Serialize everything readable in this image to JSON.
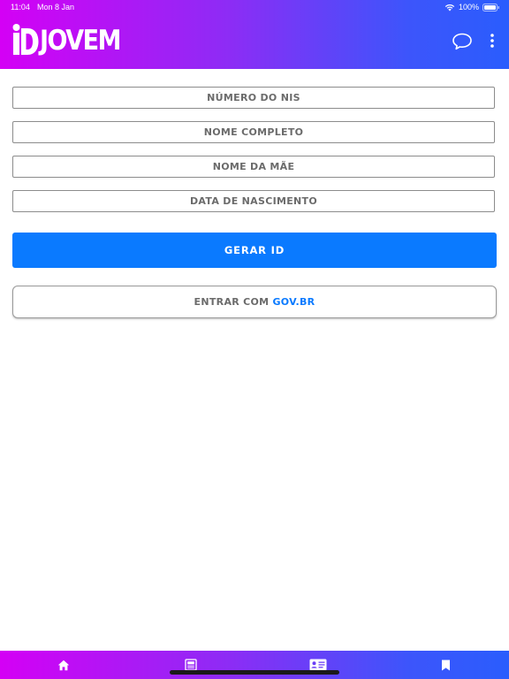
{
  "status_bar": {
    "time": "11:04",
    "date": "Mon 8 Jan",
    "battery": "100%"
  },
  "header": {
    "logo_text": "JOVEM",
    "logo_mark": "iD"
  },
  "form": {
    "nis_placeholder": "NÚMERO DO NIS",
    "name_placeholder": "NOME COMPLETO",
    "mother_placeholder": "NOME DA MÃE",
    "birth_placeholder": "DATA DE NASCIMENTO"
  },
  "actions": {
    "generate_label": "GERAR ID",
    "govbr_prefix": "ENTRAR COM",
    "govbr_brand": "GOV.BR"
  },
  "tabbar": {
    "items": [
      "home-icon",
      "news-icon",
      "id-card-icon",
      "bookmark-icon"
    ]
  },
  "colors": {
    "gradient_start": "#d400f5",
    "gradient_end": "#2a5dfd",
    "primary": "#0a7aff",
    "field_text": "#6b6b6b"
  }
}
